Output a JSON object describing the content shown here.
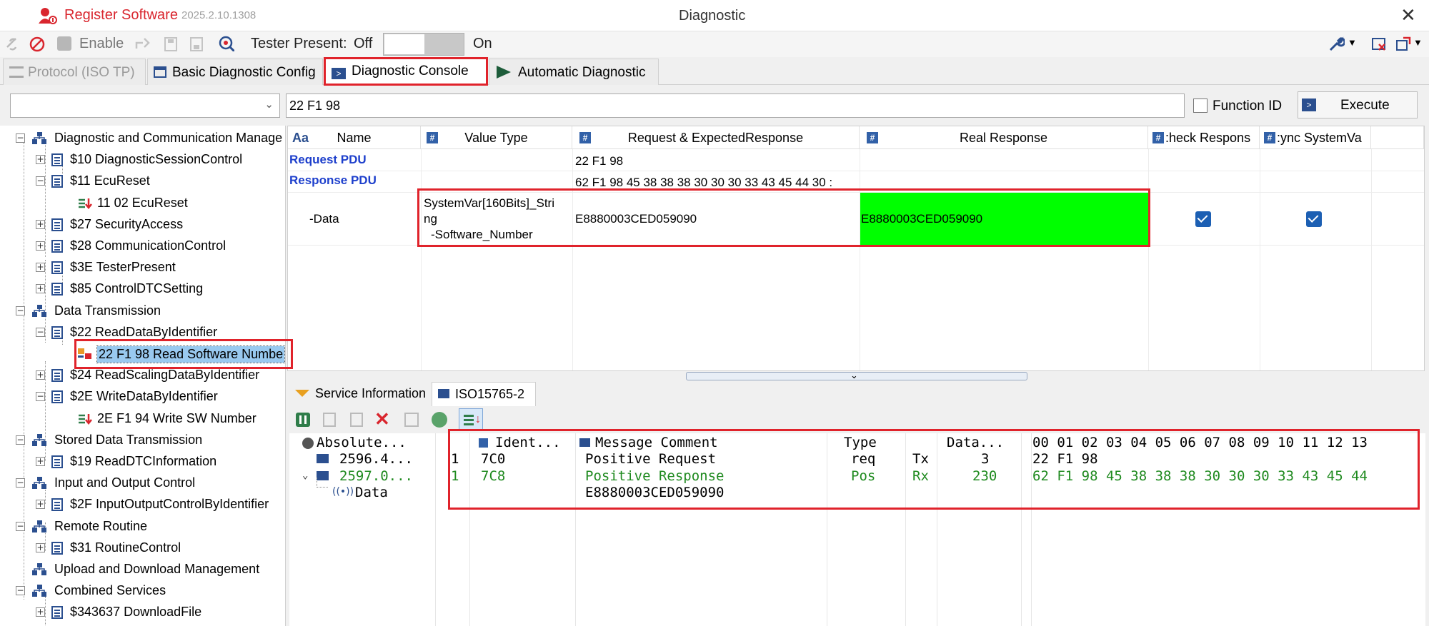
{
  "app": {
    "register_label": "Register Software",
    "version": "2025.2.10.1308",
    "window_title": "Diagnostic",
    "close_glyph": "✕"
  },
  "toolbar": {
    "enable_label": "Enable",
    "tester_present_label": "Tester Present:",
    "off_label": "Off",
    "on_label": "On",
    "tester_present_on": false
  },
  "tabs": [
    {
      "label": "Protocol (ISO TP)",
      "active": false,
      "disabled": true
    },
    {
      "label": "Basic Diagnostic Config",
      "active": false
    },
    {
      "label": "Diagnostic Console",
      "active": true
    },
    {
      "label": "Automatic Diagnostic",
      "active": false
    }
  ],
  "command": {
    "selected": "",
    "input_value": "22 F1 98",
    "function_id_label": "Function ID",
    "function_id_checked": false,
    "execute_label": "Execute"
  },
  "tree": [
    {
      "label": "Diagnostic and Communication Manage"
    },
    {
      "label": "$10 DiagnosticSessionControl"
    },
    {
      "label": "$11 EcuReset"
    },
    {
      "label": "11 02 EcuReset"
    },
    {
      "label": "$27 SecurityAccess"
    },
    {
      "label": "$28 CommunicationControl"
    },
    {
      "label": "$3E TesterPresent"
    },
    {
      "label": "$85 ControlDTCSetting"
    },
    {
      "label": "Data Transmission"
    },
    {
      "label": "$22 ReadDataByIdentifier"
    },
    {
      "label": "22 F1 98 Read Software Numbe",
      "selected": true
    },
    {
      "label": "$24 ReadScalingDataByIdentifier"
    },
    {
      "label": "$2E WriteDataByIdentifier"
    },
    {
      "label": "2E F1 94 Write SW Number"
    },
    {
      "label": "Stored Data Transmission"
    },
    {
      "label": "$19 ReadDTCInformation"
    },
    {
      "label": "Input and Output Control"
    },
    {
      "label": "$2F InputOutputControlByIdentifier"
    },
    {
      "label": "Remote Routine"
    },
    {
      "label": "$31 RoutineControl"
    },
    {
      "label": "Upload and Download Management"
    },
    {
      "label": "Combined Services"
    },
    {
      "label": "$343637 DownloadFile"
    }
  ],
  "grid": {
    "headers": {
      "name_prefix": "Aa",
      "name": "Name",
      "value_type": "Value Type",
      "request": "Request & ExpectedResponse",
      "real": "Real Response",
      "check": ":heck Respons",
      "sync": ":ync SystemVa"
    },
    "rows": {
      "request_pdu_label": "Request PDU",
      "request_pdu_value": "22 F1 98",
      "response_pdu_label": "Response PDU",
      "response_pdu_value": "62 F1 98 45 38 38 38 30 30 30 33 43 45 44 30 :",
      "data_label": "-Data",
      "data_type_line1": "SystemVar[160Bits]_Stri",
      "data_type_line2": "ng",
      "data_type_line3": "-Software_Number",
      "data_expected": "E8880003CED059090",
      "data_real": "E8880003CED059090",
      "check_response": true,
      "sync_system_var": true
    },
    "real_response_color": "#00ff00"
  },
  "lower_tabs": [
    {
      "label": "Service Information",
      "active": false
    },
    {
      "label": "ISO15765-2",
      "active": true
    }
  ],
  "trace": {
    "headers": {
      "absolute": "Absolute...",
      "ident": "Ident...",
      "message": "Message Comment",
      "type": "Type",
      "data": "Data...",
      "bytes": "00 01 02 03 04 05 06 07 08 09 10 11 12 13"
    },
    "rows": [
      {
        "time": "2596.4...",
        "ch": "1",
        "ident": "7C0",
        "comment": "Positive Request",
        "type": "req",
        "dir": "Tx",
        "len": "3",
        "bytes": "22 F1 98"
      },
      {
        "time": "2597.0...",
        "ch": "1",
        "ident": "7C8",
        "comment": "Positive Response",
        "type": "Pos",
        "dir": "Rx",
        "len": "230",
        "bytes": "62 F1 98 45 38 38 38 30 30 30 33 43 45 44"
      }
    ],
    "data_child_label": "Data",
    "data_child_value": "E8880003CED059090",
    "response_color": "#1f8a1f"
  }
}
